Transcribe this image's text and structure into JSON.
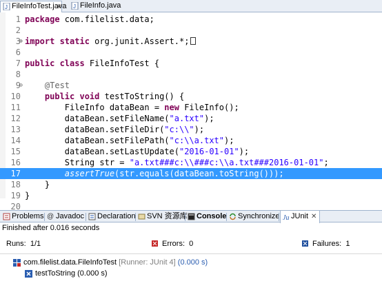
{
  "editor_tabs": [
    {
      "label": "FileInfoTest.java",
      "close": "✕"
    },
    {
      "label": "FileInfo.java"
    }
  ],
  "code_lines": [
    {
      "n": "1"
    },
    {
      "n": "2"
    },
    {
      "n": "3"
    },
    {
      "n": "6"
    },
    {
      "n": "7"
    },
    {
      "n": "8"
    },
    {
      "n": "9"
    },
    {
      "n": "10"
    },
    {
      "n": "11"
    },
    {
      "n": "12"
    },
    {
      "n": "13"
    },
    {
      "n": "14"
    },
    {
      "n": "15"
    },
    {
      "n": "16"
    },
    {
      "n": "17"
    },
    {
      "n": "18"
    },
    {
      "n": "19"
    },
    {
      "n": "20"
    }
  ],
  "code": {
    "l1_kw": "package",
    "l1_rest": " com.filelist.data;",
    "l3_kw": "import static",
    "l3_rest": " org.junit.Assert.*;",
    "l7_kw": "public class",
    "l7_rest": " FileInfoTest {",
    "l9_ann": "@Test",
    "l10_kw": "public void",
    "l10_rest": " testToString() {",
    "l11_a": "FileInfo dataBean = ",
    "l11_kw": "new",
    "l11_b": " FileInfo();",
    "l12_a": "dataBean.setFileName(",
    "l12_s": "\"a.txt\"",
    "l12_b": ");",
    "l13_a": "dataBean.setFileDir(",
    "l13_s": "\"c:\\\\\"",
    "l13_b": ");",
    "l14_a": "dataBean.setFilePath(",
    "l14_s": "\"c:\\\\a.txt\"",
    "l14_b": ");",
    "l15_a": "dataBean.setLastUpdate(",
    "l15_s": "\"2016-01-01\"",
    "l15_b": ");",
    "l16_a": "String str = ",
    "l16_s": "\"a.txt###c:\\\\###c:\\\\a.txt###2016-01-01\"",
    "l16_b": ";",
    "l17_it": "assertTrue",
    "l17_rest": "(str.equals(dataBean.toString()));",
    "l18": "}",
    "l19": "}"
  },
  "panel_tabs": [
    {
      "label": "Problems"
    },
    {
      "label": "Javadoc"
    },
    {
      "label": "Declaration"
    },
    {
      "label": "SVN 资源库"
    },
    {
      "label": "Console"
    },
    {
      "label": "Synchronize"
    },
    {
      "label": "JUnit",
      "close": "✕"
    }
  ],
  "junit": {
    "status": "Finished after 0.016 seconds",
    "runs_label": "Runs:",
    "runs_value": "1/1",
    "errors_label": "Errors:",
    "errors_value": "0",
    "failures_label": "Failures:",
    "failures_value": "1"
  },
  "tree": {
    "suite": "com.filelist.data.FileInfoTest",
    "runner": "[Runner: JUnit 4]",
    "suite_time": "(0.000 s)",
    "test": "testToString (0.000 s)"
  },
  "colors": {
    "keyword": "#7f0055",
    "string": "#2a00ff",
    "highlight": "#3399ff",
    "failure": "#1f4f9e",
    "error": "#c62828"
  },
  "icons": {
    "java_file": "java-file-icon",
    "suite": "junit-suite-icon",
    "test": "junit-test-icon"
  }
}
